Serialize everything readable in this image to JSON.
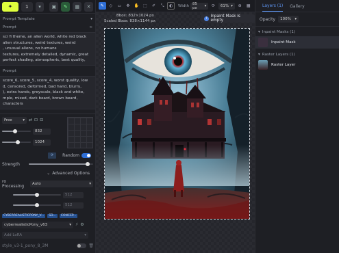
{
  "left": {
    "batch_count": "1",
    "prompt_template_label": "Prompt Template",
    "prompt_label": "Prompt",
    "prompt_lines": [
      "sci fi theme, an alien world, white red black",
      "alien structures, weird textures, weird",
      ", unusual aliens, no humans",
      "textures, extremely detailed, dynamic, great",
      "perfect shading, atmospheric, best quality,"
    ],
    "negative_label": "Prompt",
    "negative_lines": [
      "score_6, score_5, score_4, worst quality, low",
      "d, censored, deformed, bad hand, blurry,",
      "), extra hands, greyscale, black and white,",
      "mple, mixed, dark beard, brown beard, characters"
    ],
    "aspect_value": "Free",
    "width_value": "832",
    "height_value": "1024",
    "random_label": "Random",
    "strength_label": "Strength",
    "advanced_label": "Advanced Options",
    "processing_label": "ro Processing",
    "processing_value": "Auto",
    "proc_val_1": "512",
    "proc_val_2": "512",
    "chips": [
      "CYBERREALISTICPONY_V...",
      "SD...",
      "CONCEP..."
    ],
    "model_value": "cyberrealisticPony_v63",
    "lora_placeholder": "Add LoRA",
    "footer_text": "style_v3-1_pony_8_3M"
  },
  "center": {
    "width_label": "Width",
    "width_value": "85 px",
    "zoom_value": "61%",
    "bbox_line1": "Bbox: 832×1024 px",
    "bbox_line2": "Scaled Bbox: 838×1144 px",
    "mask_status": "Inpaint Mask is empty"
  },
  "right": {
    "tabs": [
      "Layers (1)",
      "Gallery"
    ],
    "opacity_label": "Opacity",
    "opacity_value": "100%",
    "inpaint_group": "Inpaint Masks (1)",
    "inpaint_layer": "Inpaint Mask",
    "raster_group": "Raster Layers (1)",
    "raster_layer": "Raster Layer"
  },
  "colors": {
    "accent_yellow": "#dfff3d",
    "accent_blue": "#2f6fd6",
    "panel_bg": "#1e1f24"
  }
}
